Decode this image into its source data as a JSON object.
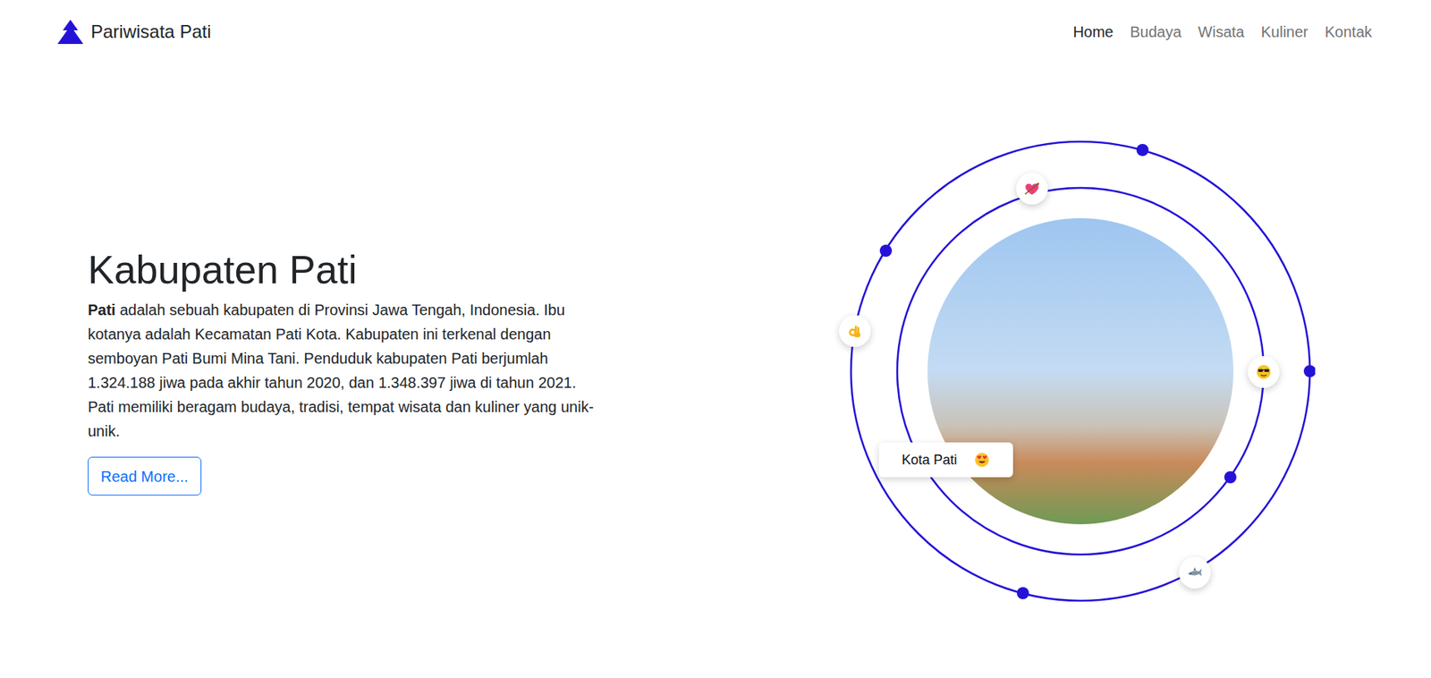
{
  "brand": {
    "name": "Pariwisata Pati"
  },
  "nav": [
    {
      "label": "Home",
      "selected": true
    },
    {
      "label": "Budaya",
      "selected": false
    },
    {
      "label": "Wisata",
      "selected": false
    },
    {
      "label": "Kuliner",
      "selected": false
    },
    {
      "label": "Kontak",
      "selected": false
    }
  ],
  "hero": {
    "title": "Kabupaten Pati",
    "paragraphs": [
      {
        "bold": "Pati",
        "text": " adalah sebuah kabupaten di Provinsi Jawa Tengah, Indonesia. Ibu kotanya adalah Kecamatan Pati Kota. Kabupaten ini terkenal dengan semboyan Pati Bumi Mina Tani. Penduduk kabupaten Pati berjumlah 1.324.188 jiwa pada akhir tahun 2020, dan 1.348.397 jiwa di tahun 2021."
      },
      {
        "bold": "",
        "text": "Pati memiliki beragam budaya, tradisi, tempat wisata dan kuliner yang unik-unik."
      }
    ],
    "button": "Read More..."
  },
  "figure": {
    "label": "Kota Pati"
  }
}
